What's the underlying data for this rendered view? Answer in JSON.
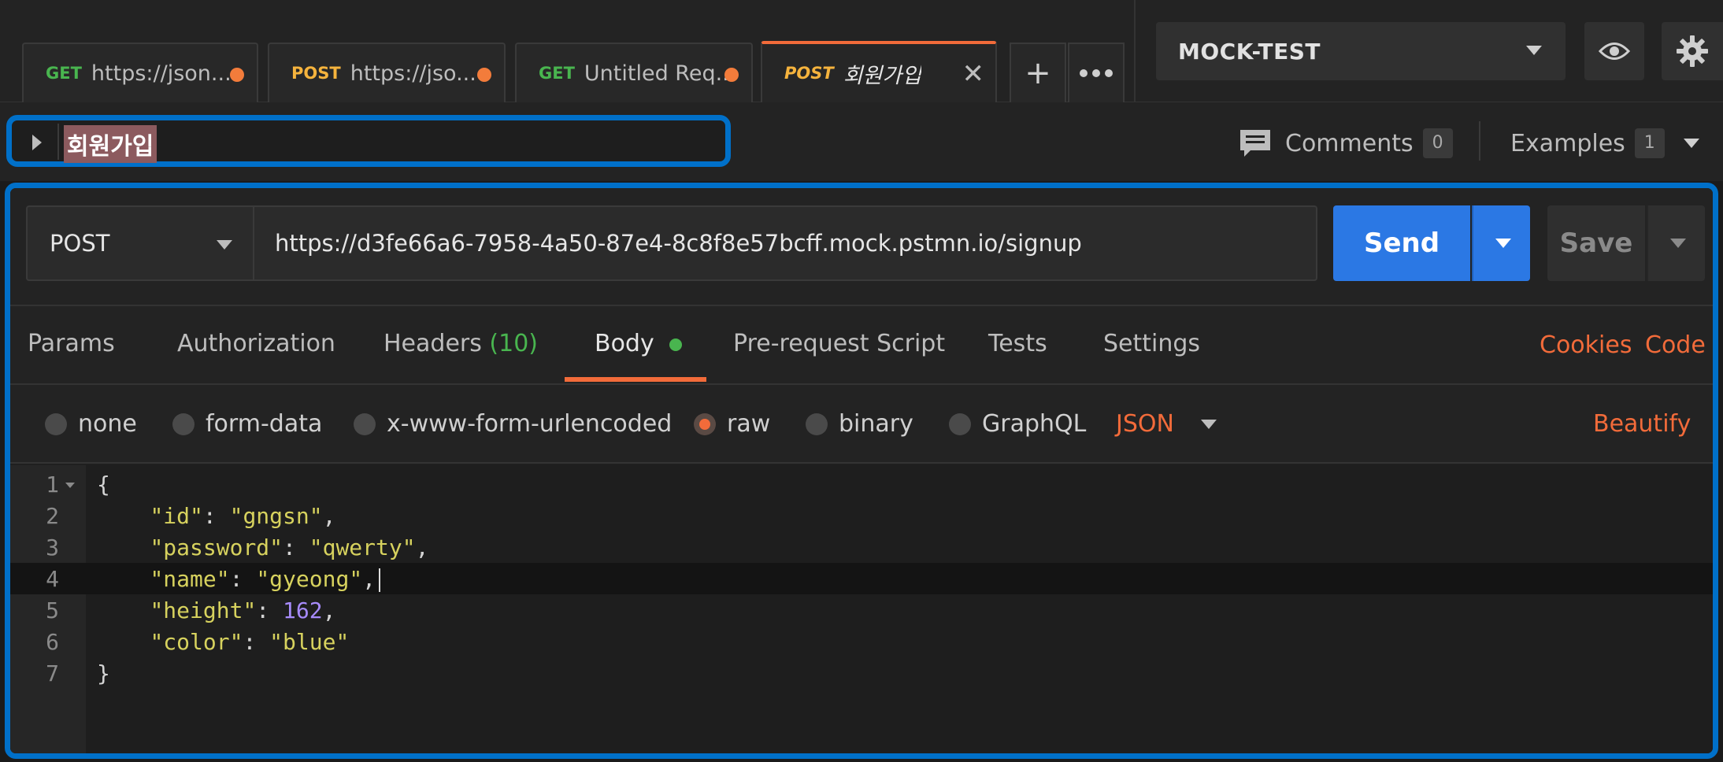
{
  "tabs": [
    {
      "method": "GET",
      "name": "https://json..."
    },
    {
      "method": "POST",
      "name": "https://jso..."
    },
    {
      "method": "GET",
      "name": "Untitled Req..."
    },
    {
      "method": "POST",
      "name": "회원가입"
    }
  ],
  "environment": {
    "selected": "MOCK-TEST"
  },
  "request": {
    "name": "회원가입",
    "comments_label": "Comments",
    "comments_count": "0",
    "examples_label": "Examples",
    "examples_count": "1",
    "method": "POST",
    "url": "https://d3fe66a6-7958-4a50-87e4-8c8f8e57bcff.mock.pstmn.io/signup",
    "send_label": "Send",
    "save_label": "Save"
  },
  "request_tabs": {
    "params": "Params",
    "authorization": "Authorization",
    "headers": "Headers",
    "headers_count": "(10)",
    "body": "Body",
    "prerequest": "Pre-request Script",
    "tests": "Tests",
    "settings": "Settings",
    "cookies": "Cookies",
    "code": "Code"
  },
  "body_options": {
    "none": "none",
    "form_data": "form-data",
    "urlencoded": "x-www-form-urlencoded",
    "raw": "raw",
    "binary": "binary",
    "graphql": "GraphQL",
    "format": "JSON",
    "beautify": "Beautify"
  },
  "editor": {
    "line_numbers": [
      "1",
      "2",
      "3",
      "4",
      "5",
      "6",
      "7"
    ],
    "l1": "{",
    "l2_key": "\"id\"",
    "l2_val": "\"gngsn\"",
    "l3_key": "\"password\"",
    "l3_val": "\"qwerty\"",
    "l4_key": "\"name\"",
    "l4_val": "\"gyeong\"",
    "l5_key": "\"height\"",
    "l5_val": "162",
    "l6_key": "\"color\"",
    "l6_val": "\"blue\"",
    "l7": "}"
  },
  "colors": {
    "accent_orange": "#f26b3a",
    "send_blue": "#2b78e4",
    "get_green": "#49b54f",
    "post_yellow": "#f5b33d",
    "highlight_border": "#0070c9"
  }
}
